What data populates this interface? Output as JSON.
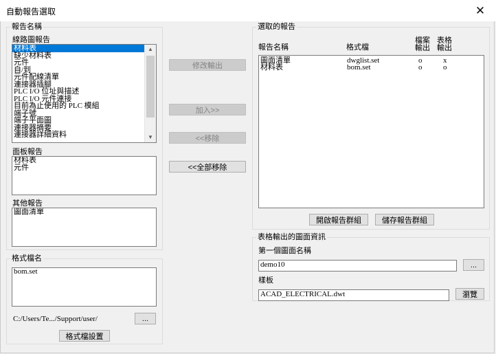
{
  "window": {
    "title": "自動報告選取",
    "close_glyph": "✕"
  },
  "report_names": {
    "group_label": "報告名稱",
    "schematic": {
      "label": "線路圖報告",
      "items": [
        "材料表",
        "缺少材料表",
        "元件",
        "自/到",
        "元件配線清單",
        "連接器插腳",
        "PLC I/O 位址與描述",
        "PLC I/O 元件連接",
        "目前為止使用的 PLC 模組",
        "端子號",
        "端子平面圖",
        "連接器摘要",
        "連接器詳細資料"
      ],
      "selected_index": 0
    },
    "panel": {
      "label": "面板報告",
      "items": [
        "材料表",
        "元件"
      ]
    },
    "other": {
      "label": "其他報告",
      "items": [
        "圖面清單"
      ]
    }
  },
  "format_name": {
    "group_label": "格式檔名",
    "items": [
      "bom.set"
    ],
    "path": "C:/Users/Te.../Support/user/",
    "browse_label": "...",
    "setup_label": "格式檔設置"
  },
  "actions": {
    "modify_output": "修改輸出",
    "add": "加入>>",
    "remove": "<<移除",
    "remove_all": "<<全部移除"
  },
  "selected_reports": {
    "group_label": "選取的報告",
    "headers": {
      "name": "報告名稱",
      "format": "格式檔",
      "file_output_1": "檔案",
      "file_output_2": "輸出",
      "table_output_1": "表格",
      "table_output_2": "輸出"
    },
    "rows": [
      {
        "name": "圖面清單",
        "format": "dwglist.set",
        "file": "o",
        "table": "x"
      },
      {
        "name": "材料表",
        "format": "bom.set",
        "file": "o",
        "table": "o"
      }
    ],
    "open_group_label": "開啟報告群組",
    "save_group_label": "儲存報告群組"
  },
  "table_drawing_info": {
    "group_label": "表格輸出的圖面資訊",
    "first_drawing_label": "第一個圖面名稱",
    "first_drawing_value": "demo10",
    "browse_label": "...",
    "template_label": "樣板",
    "template_value": "ACAD_ELECTRICAL.dwt",
    "template_browse_label": "瀏覽"
  }
}
